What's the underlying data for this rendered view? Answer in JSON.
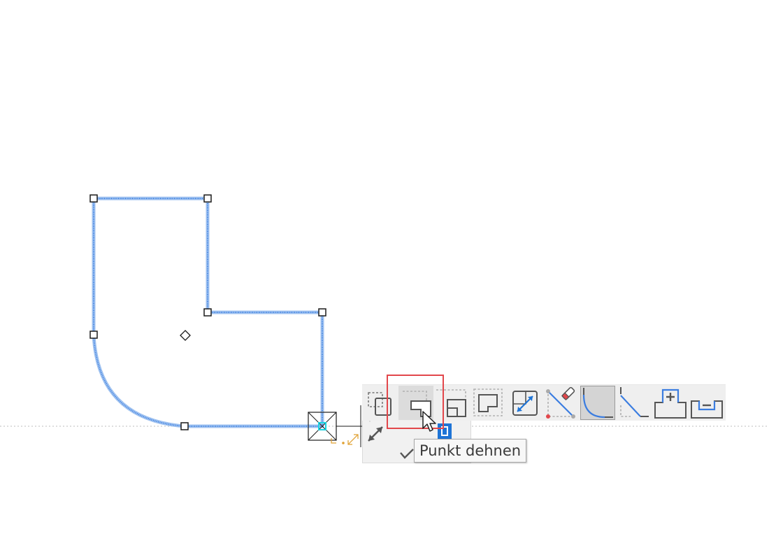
{
  "toolbar": {
    "tools": [
      {
        "name": "tool-select-edge",
        "state": "normal"
      },
      {
        "name": "tool-stretch-point",
        "state": "hover"
      },
      {
        "name": "tool-corner-shape",
        "state": "normal"
      },
      {
        "name": "tool-corner-shape-dashed",
        "state": "normal"
      },
      {
        "name": "tool-move-diagonal",
        "state": "normal"
      },
      {
        "name": "tool-erase-line",
        "state": "normal"
      },
      {
        "name": "tool-fillet",
        "state": "selected"
      },
      {
        "name": "tool-chamfer",
        "state": "normal"
      },
      {
        "name": "tool-add-notch",
        "state": "normal"
      },
      {
        "name": "tool-remove-notch",
        "state": "normal"
      }
    ]
  },
  "tooltip": {
    "text": "Punkt dehnen"
  },
  "colors": {
    "shape_outline": "#3b7de0",
    "handle": "#1a1a1a",
    "highlight": "#e2474b",
    "accent_blue": "#1e74d6",
    "tooltip_bg": "#f7f7f7"
  }
}
